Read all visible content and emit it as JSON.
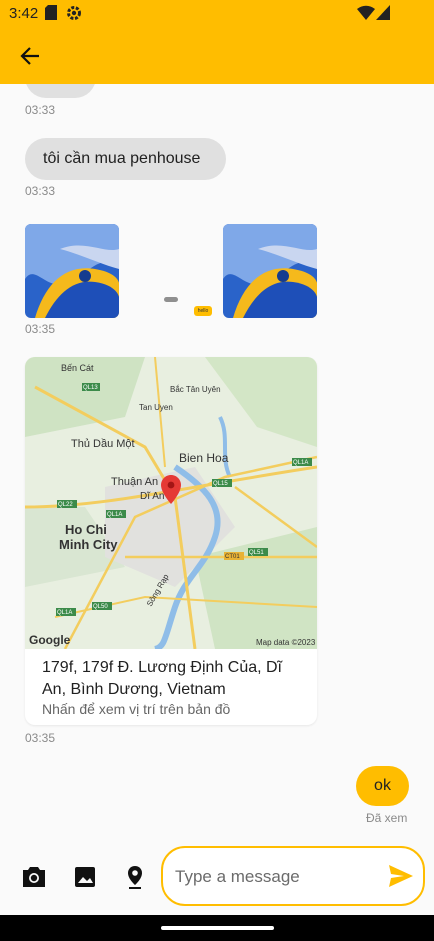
{
  "status_bar": {
    "time": "3:42"
  },
  "messages": {
    "m1_time": "03:33",
    "m2_text": "tôi cần mua penhouse",
    "m2_time": "03:33",
    "m3_time": "03:35",
    "m3_sticker_text": "hello",
    "m4_address": "179f, 179f Đ. Lương Định Của, Dĩ An, Bình Dương, Vietnam",
    "m4_hint": "Nhấn để xem vị trí trên bản đồ",
    "m4_time": "03:35",
    "m5_text": "ok",
    "m5_status": "Đã xem"
  },
  "map": {
    "labels": [
      "Bến Cát",
      "Bắc Tân Uyên",
      "Tan Uyen",
      "Thủ Dầu Một",
      "Bien Hoa",
      "Thuận An",
      "Dĩ An",
      "Ho Chi",
      "Minh City",
      "Sông Rạp"
    ],
    "roads": [
      "QL13",
      "QL1A",
      "QL15",
      "QL22",
      "QL1A",
      "CT01",
      "QL51",
      "QL1A",
      "QL50"
    ],
    "google": "Google",
    "attribution": "Map data ©2023"
  },
  "composer": {
    "placeholder": "Type a message"
  },
  "colors": {
    "accent": "#ffbd00",
    "incoming_bubble": "#e0e0e0"
  }
}
